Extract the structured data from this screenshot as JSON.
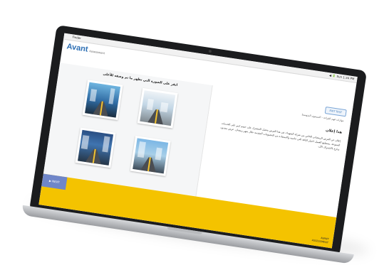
{
  "menubar": {
    "app_name": "Finder",
    "status_text": "◀︎ 🔋 Sun 1:34 PM"
  },
  "app": {
    "logo": "Avant",
    "logo_sub": "Assessment"
  },
  "question": {
    "prompt": "انقر على الصورة التي تظهر ما تم وصفه للأعلى"
  },
  "header": {
    "exit_label": "EXIT TEST"
  },
  "hint": {
    "breadcrumb": "مهارات فهم القراءة – المستوى المتوسط",
    "title": "هذا إعلان",
    "body": "إعلان عن العرض الرمضاني الخاص من شركة الشهداء. في هذا العرض يحصل المشترك على خصم كبير على الخدمات المتنوعة. يستطيع العميل اختيار الباقة التي تناسبه والاستفادة من الخصومات المقدمة خلال شهر رمضان. عرض محدود، سارع بالاشتراك الآن."
  },
  "footer": {
    "next_label": "▶ NEXT",
    "brand_line1": "AVANT",
    "brand_line2": "ASSESSMENT"
  },
  "images": [
    {
      "name": "city-road-image-1"
    },
    {
      "name": "city-road-image-2"
    },
    {
      "name": "city-road-image-3"
    },
    {
      "name": "city-road-image-4"
    }
  ]
}
